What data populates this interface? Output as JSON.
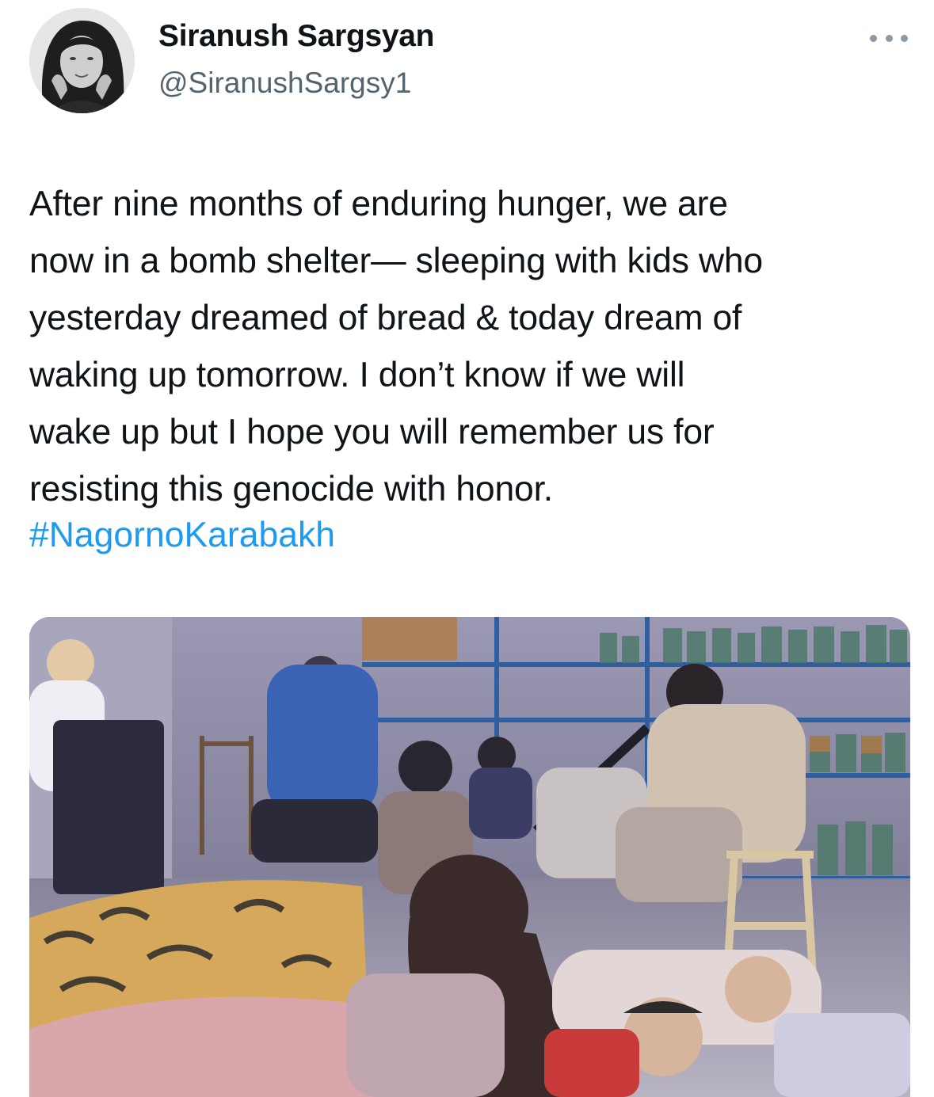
{
  "author": {
    "name": "Siranush Sargsyan",
    "handle": "@SiranushSargsy1"
  },
  "tweet": {
    "lines": [
      "After nine months of enduring hunger, we are",
      "now in a bomb shelter— sleeping with kids who",
      "yesterday dreamed of bread & today dream of",
      "waking up tomorrow. I don’t know if we will",
      "wake up but I hope you will remember us for",
      "resisting this genocide with honor."
    ],
    "hashtag": "#NagornoKarabakh"
  },
  "icons": {
    "more": "more-options-icon"
  },
  "colors": {
    "text": "#0f1419",
    "secondary": "#536471",
    "link": "#1d9bf0"
  }
}
